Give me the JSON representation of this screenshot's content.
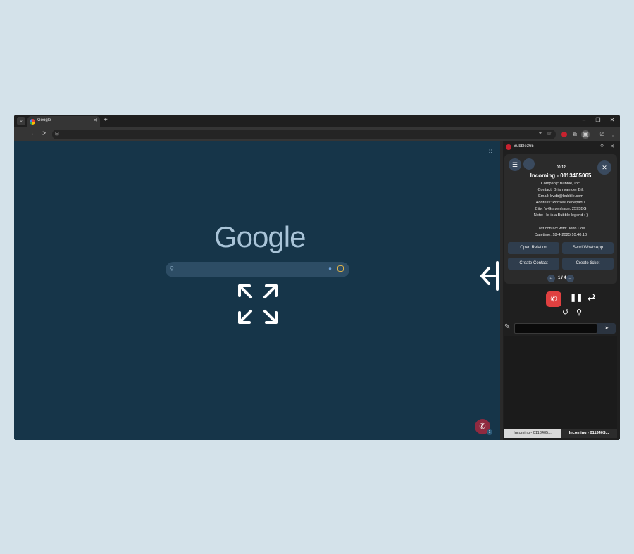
{
  "browser": {
    "tab_title": "Google",
    "tab_close": "✕",
    "new_tab": "+",
    "tab_search": "⌄",
    "window_controls": {
      "minimize": "–",
      "restore": "❐",
      "close": "✕"
    },
    "nav": {
      "back": "←",
      "forward": "→",
      "reload": "⟳"
    },
    "omnibox": {
      "tune": "⊟",
      "location": "⌖",
      "star": "☆",
      "placeholder": ""
    },
    "toolbar_icons": {
      "extensions": "⧉",
      "cast": "⎚",
      "menu": "⋮",
      "sidepanel": "▣"
    }
  },
  "google": {
    "logo": "Google",
    "apps": "⠿",
    "search_icon": "⚲",
    "mic_icon": "🎙"
  },
  "fab": {
    "icon": "✆",
    "badge": "1"
  },
  "panel": {
    "title": "Bubble365",
    "pin": "⚲",
    "close": "✕",
    "menu_icon": "☰",
    "back_icon": "←",
    "close_icon": "✕",
    "timer": "00:12",
    "call_title": "Incoming - 0113405065",
    "info": [
      "Company: Bubble, Inc.",
      "Contact: Brian van der Bilt",
      "Email: bvdb@bubble.com",
      "Address: Prinses Irenepad 1",
      "City: 's-Gravenhage, 2595BG",
      "Note: He is a Bubble legend :-)",
      "",
      "Last contact with: John Doe",
      "Datetime: 18-4-2025 10:40:10"
    ],
    "actions": [
      "Open Relation",
      "Send WhatsApp",
      "Create Contact",
      "Create ticket"
    ],
    "pager": {
      "prev": "←",
      "text": "1 / 4",
      "next": "→"
    },
    "controls": {
      "hangup": "✆",
      "pause": "❚❚",
      "transfer": "⇄",
      "history": "↺",
      "search": "⚲"
    },
    "compose_icon": "✎",
    "note_value": "",
    "send": "➤",
    "bottom_tabs": [
      "Incoming - 0113405...",
      "Incoming - 011340S..."
    ]
  },
  "colors": {
    "content_bg": "#163549",
    "panel_bg": "#1f1f1f",
    "hangup": "#e04040",
    "action_button": "#2f3d4d"
  }
}
